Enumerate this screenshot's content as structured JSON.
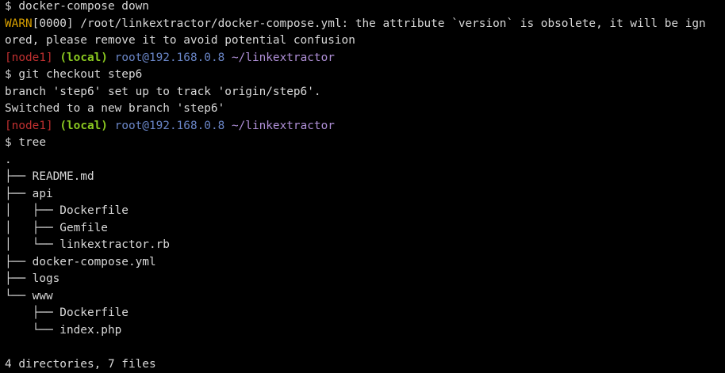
{
  "terminal": {
    "colors": {
      "background": "#000000",
      "text": "#d8d8d8",
      "warn": "#d8a000",
      "node": "#c03030",
      "local": "#8ac820",
      "user": "#6a86c8",
      "path": "#b090d8"
    },
    "lines": {
      "cmd1": "$ docker-compose down",
      "warn_tag": "WARN",
      "warn_text": "[0000] /root/linkextractor/docker-compose.yml: the attribute `version` is obsolete, it will be ign",
      "warn_cont": "ored, please remove it to avoid potential confusion",
      "prompt1": {
        "node": "[node1]",
        "local": "(local)",
        "user": "root@192.168.0.8",
        "path": "~/linkextractor"
      },
      "cmd2": "$ git checkout step6",
      "out2a": "branch 'step6' set up to track 'origin/step6'.",
      "out2b": "Switched to a new branch 'step6'",
      "prompt2": {
        "node": "[node1]",
        "local": "(local)",
        "user": "root@192.168.0.8",
        "path": "~/linkextractor"
      },
      "cmd3": "$ tree",
      "tree": [
        ".",
        "├── README.md",
        "├── api",
        "│   ├── Dockerfile",
        "│   ├── Gemfile",
        "│   └── linkextractor.rb",
        "├── docker-compose.yml",
        "├── logs",
        "└── www",
        "    ├── Dockerfile",
        "    └── index.php"
      ],
      "summary": "4 directories, 7 files"
    }
  }
}
